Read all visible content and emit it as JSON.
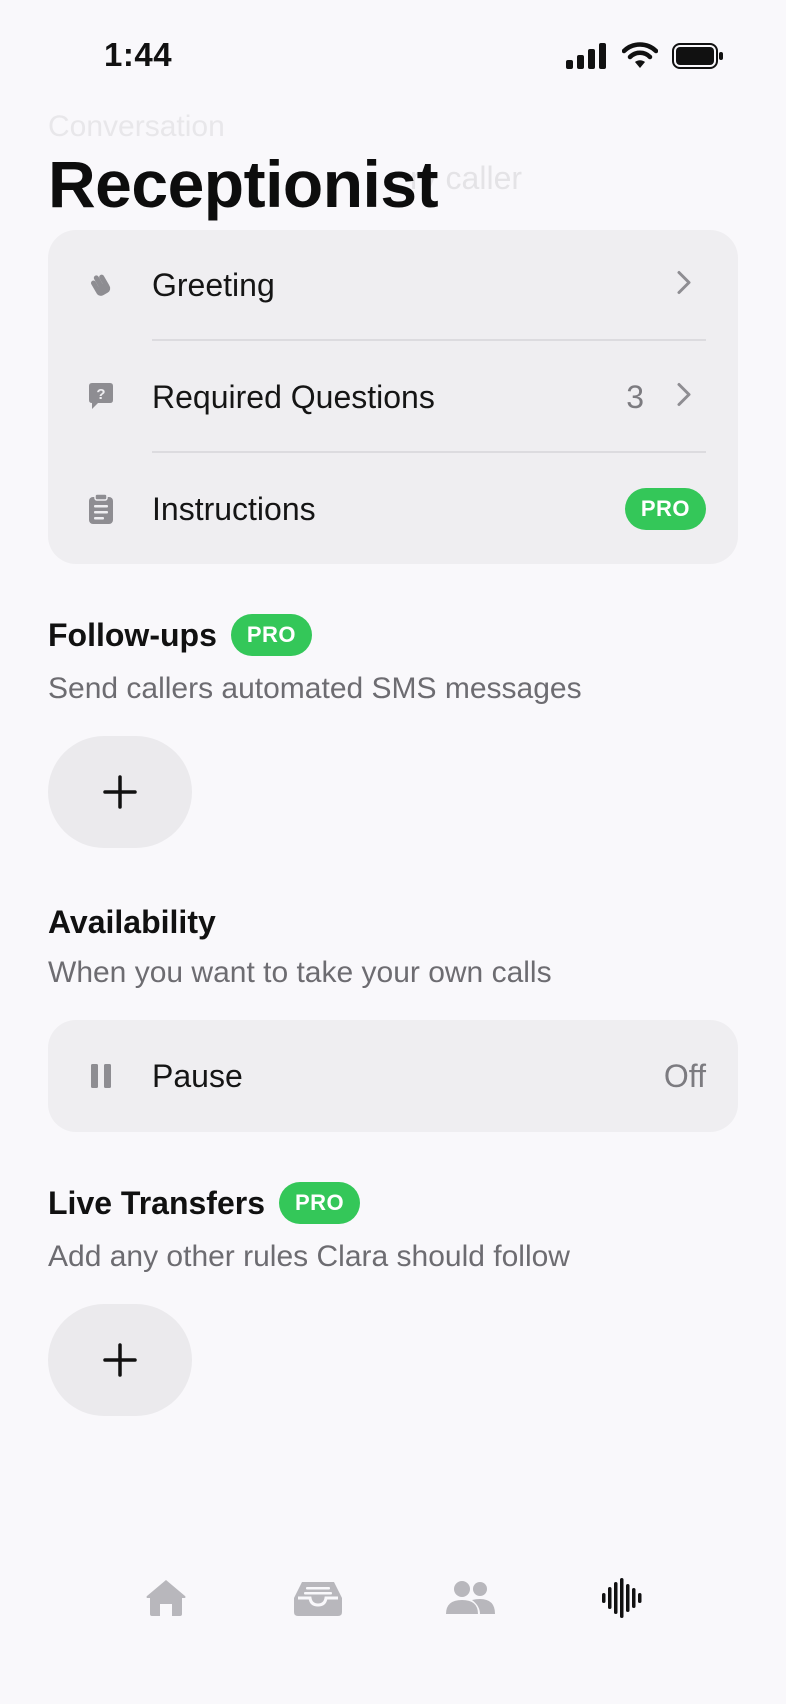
{
  "status_bar": {
    "time": "1:44"
  },
  "background_ghost": {
    "title": "Conversation",
    "subtitle": "ry caller"
  },
  "page": {
    "title": "Receptionist"
  },
  "receptionist_card": {
    "items": [
      {
        "label": "Greeting",
        "icon": "wave-hand-icon"
      },
      {
        "label": "Required Questions",
        "value": "3",
        "icon": "question-bubble-icon"
      },
      {
        "label": "Instructions",
        "badge": "PRO",
        "icon": "clipboard-icon"
      }
    ]
  },
  "followups": {
    "title": "Follow-ups",
    "badge": "PRO",
    "subtitle": "Send callers automated SMS messages",
    "add_label": "+"
  },
  "availability": {
    "title": "Availability",
    "subtitle": "When you want to take your own calls",
    "pause_label": "Pause",
    "pause_value": "Off"
  },
  "live_transfers": {
    "title": "Live Transfers",
    "badge": "PRO",
    "subtitle": "Add any other rules Clara should follow",
    "add_label": "+"
  },
  "tab_bar": {
    "tabs": [
      {
        "icon": "home-icon",
        "active": false
      },
      {
        "icon": "inbox-icon",
        "active": false
      },
      {
        "icon": "people-icon",
        "active": false
      },
      {
        "icon": "waveform-icon",
        "active": true
      }
    ]
  },
  "colors": {
    "accent_green": "#34c759",
    "background": "#f9f8fb",
    "card": "#efeef1",
    "muted_text": "#6d6c71"
  }
}
